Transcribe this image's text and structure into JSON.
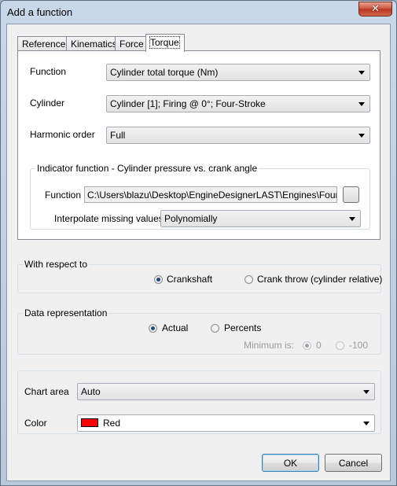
{
  "window": {
    "title": "Add a function",
    "close_glyph": "✕"
  },
  "tabs": [
    {
      "label": "Reference"
    },
    {
      "label": "Kinematics"
    },
    {
      "label": "Force"
    },
    {
      "label": "Torque"
    }
  ],
  "torque": {
    "function_label": "Function",
    "function_value": "Cylinder total torque (Nm)",
    "cylinder_label": "Cylinder",
    "cylinder_value": "Cylinder [1]; Firing @ 0°; Four-Stroke",
    "harmonic_label": "Harmonic order",
    "harmonic_value": "Full"
  },
  "indicator": {
    "title": "Indicator function - Cylinder pressure vs. crank angle",
    "function_label": "Function",
    "function_path": "C:\\Users\\blazu\\Desktop\\EngineDesignerLAST\\Engines\\FourStroke",
    "interpolate_label": "Interpolate missing values:",
    "interpolate_value": "Polynomially"
  },
  "respect": {
    "title": "With respect to",
    "options": [
      "Crankshaft",
      "Crank throw (cylinder relative)"
    ],
    "selected": "Crankshaft"
  },
  "representation": {
    "title": "Data representation",
    "options": [
      "Actual",
      "Percents"
    ],
    "selected": "Actual",
    "minimum_label": "Minimum is:",
    "minimum_options": [
      "0",
      "-100"
    ],
    "minimum_selected": "0"
  },
  "chart": {
    "area_label": "Chart area",
    "area_value": "Auto",
    "color_label": "Color",
    "color_value": "Red",
    "color_hex": "#ff0000"
  },
  "buttons": {
    "ok": "OK",
    "cancel": "Cancel"
  }
}
